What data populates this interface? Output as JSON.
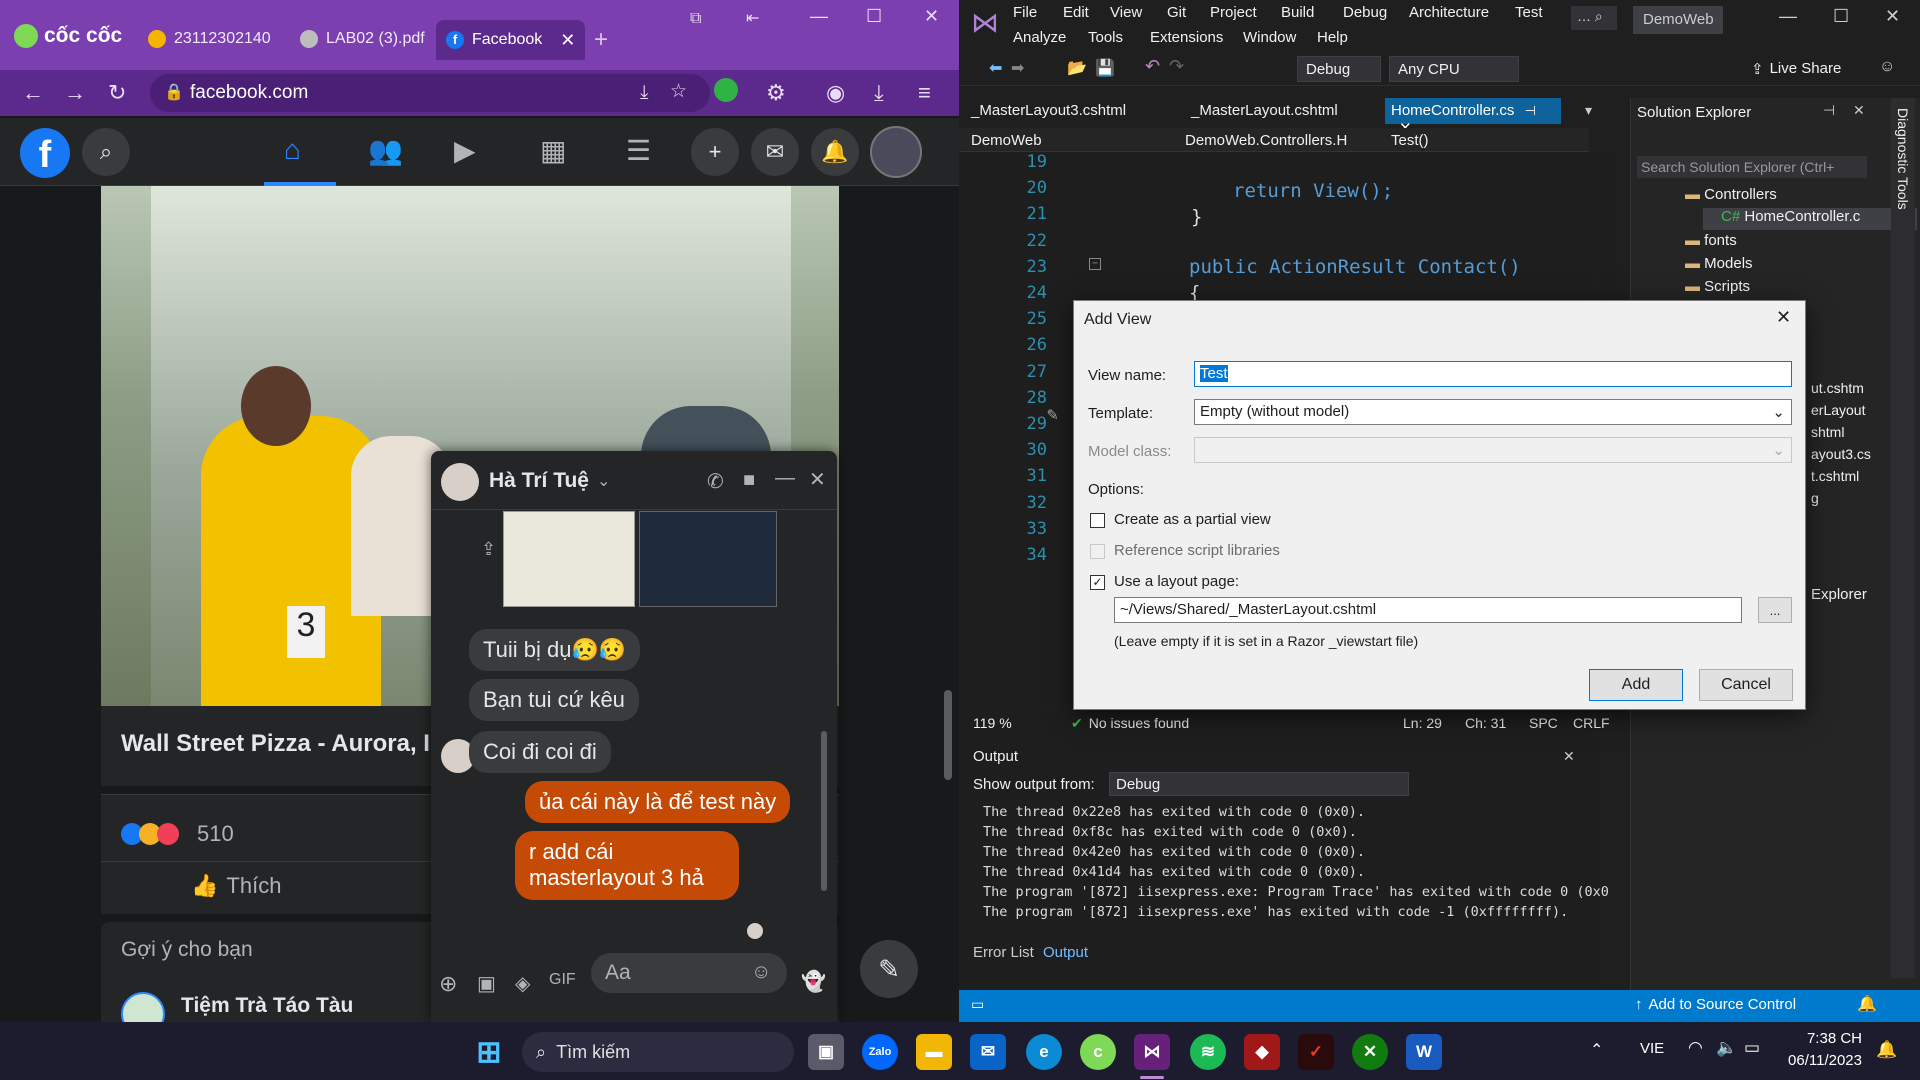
{
  "browser": {
    "logo_text": "cốc cốc",
    "tabs": [
      {
        "label": "23112302140"
      },
      {
        "label": "LAB02 (3).pdf"
      },
      {
        "label": "Facebook"
      }
    ],
    "url": "facebook.com"
  },
  "facebook": {
    "post_title": "Wall Street Pizza - Aurora, I",
    "reaction_count": "510",
    "like_label": "Thích",
    "suggest_title": "Gợi ý cho bạn",
    "suggest_page": "Tiệm Trà Táo Tàu",
    "photo_number": "3"
  },
  "chat": {
    "name": "Hà Trí Tuệ",
    "messages": [
      {
        "dir": "in",
        "text": "Tuii bị dụ😥😥"
      },
      {
        "dir": "in",
        "text": "Bạn tui cứ kêu"
      },
      {
        "dir": "in",
        "text": "Coi đi coi đi"
      },
      {
        "dir": "out",
        "text": "ủa cái này là để test này"
      },
      {
        "dir": "out",
        "text": "r add cái masterlayout 3 hả"
      }
    ],
    "input_placeholder": "Aa"
  },
  "vs": {
    "menu": [
      "File",
      "Edit",
      "View",
      "Git",
      "Project",
      "Build",
      "Debug",
      "Architecture",
      "Test",
      "Analyze",
      "Tools",
      "Extensions",
      "Window",
      "Help"
    ],
    "solution_name": "DemoWeb",
    "config": "Debug",
    "platform": "Any CPU",
    "live_share": "Live Share",
    "editor_tabs": [
      "_MasterLayout3.cshtml",
      "_MasterLayout.cshtml",
      "HomeController.cs"
    ],
    "nav_project": "DemoWeb",
    "nav_class": "DemoWeb.Controllers.H",
    "nav_member": "Test()",
    "line_numbers": [
      "19",
      "20",
      "21",
      "22",
      "23",
      "24",
      "25",
      "26",
      "27",
      "28",
      "29",
      "30",
      "31",
      "32",
      "33",
      "34"
    ],
    "code_lines": [
      {
        "line": "20",
        "text": "return View();"
      },
      {
        "line": "21",
        "text": "}"
      },
      {
        "line": "23",
        "text": "public ActionResult Contact()"
      },
      {
        "line": "24",
        "text": "{"
      }
    ],
    "zoom": "119 %",
    "issues": "No issues found",
    "ln": "Ln: 29",
    "ch": "Ch: 31",
    "spc": "SPC",
    "crlf": "CRLF",
    "solution_explorer": {
      "title": "Solution Explorer",
      "search_placeholder": "Search Solution Explorer (Ctrl+",
      "items": [
        "Controllers",
        "HomeController.c",
        "fonts",
        "Models",
        "Scripts"
      ],
      "partial_items": [
        "ut.cshtm",
        "erLayout",
        "shtml",
        "ayout3.cs",
        "t.cshtml",
        "g"
      ],
      "explorer_label": "Explorer"
    },
    "output": {
      "title": "Output",
      "show_from_label": "Show output from:",
      "show_from_value": "Debug",
      "lines": [
        "The thread 0x22e8 has exited with code 0 (0x0).",
        "The thread 0xf8c has exited with code 0 (0x0).",
        "The thread 0x42e0 has exited with code 0 (0x0).",
        "The thread 0x41d4 has exited with code 0 (0x0).",
        "The program '[872] iisexpress.exe: Program Trace' has exited with code 0 (0x0",
        "The program '[872] iisexpress.exe' has exited with code -1 (0xffffffff)."
      ],
      "tabs": [
        "Error List",
        "Output"
      ]
    },
    "statusbar_source_control": "Add to Source Control",
    "diagnostic_tools": "Diagnostic Tools"
  },
  "dialog": {
    "title": "Add View",
    "view_name_label": "View name:",
    "view_name_value": "Test",
    "template_label": "Template:",
    "template_value": "Empty (without model)",
    "model_class_label": "Model class:",
    "options_label": "Options:",
    "partial_label": "Create as a partial view",
    "reference_label": "Reference script libraries",
    "layout_label": "Use a layout page:",
    "layout_path": "~/Views/Shared/_MasterLayout.cshtml",
    "layout_hint": "(Leave empty if it is set in a Razor _viewstart file)",
    "browse_label": "...",
    "add_label": "Add",
    "cancel_label": "Cancel"
  },
  "taskbar": {
    "search_label": "Tìm kiếm",
    "language": "VIE",
    "time": "7:38 CH",
    "date": "06/11/2023"
  }
}
